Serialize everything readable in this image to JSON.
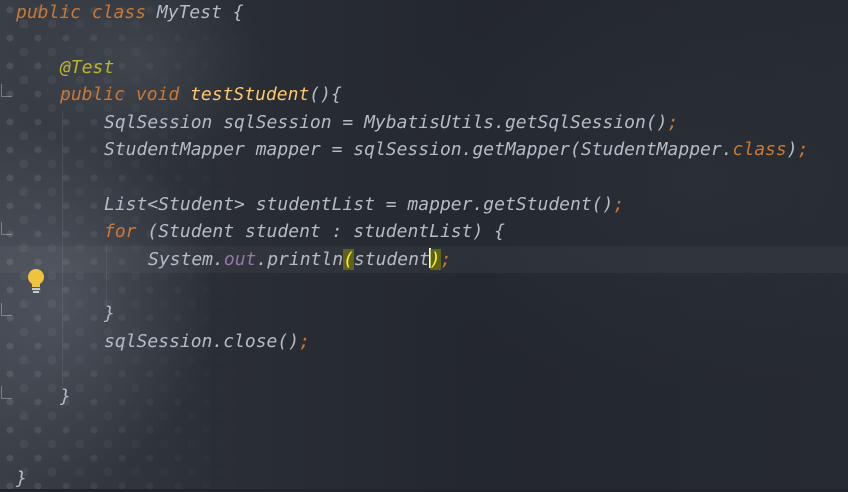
{
  "editor": {
    "lines": [
      {
        "indent": 0,
        "tokens": [
          {
            "t": "public",
            "c": "kw"
          },
          {
            "t": " ",
            "c": "plain"
          },
          {
            "t": "class",
            "c": "kw"
          },
          {
            "t": " MyTest {",
            "c": "plain"
          }
        ]
      },
      {
        "indent": 0,
        "tokens": []
      },
      {
        "indent": 1,
        "tokens": [
          {
            "t": "@Test",
            "c": "ann"
          }
        ]
      },
      {
        "indent": 1,
        "tokens": [
          {
            "t": "public",
            "c": "kw"
          },
          {
            "t": " ",
            "c": "plain"
          },
          {
            "t": "void",
            "c": "kw"
          },
          {
            "t": " ",
            "c": "plain"
          },
          {
            "t": "testStudent",
            "c": "fn"
          },
          {
            "t": "(){",
            "c": "plain"
          }
        ]
      },
      {
        "indent": 2,
        "tokens": [
          {
            "t": "SqlSession sqlSession = MybatisUtils.getSqlSession()",
            "c": "plain"
          },
          {
            "t": ";",
            "c": "punct"
          }
        ]
      },
      {
        "indent": 2,
        "tokens": [
          {
            "t": "StudentMapper mapper = sqlSession.getMapper(StudentMapper.",
            "c": "plain"
          },
          {
            "t": "class",
            "c": "kw"
          },
          {
            "t": ")",
            "c": "plain"
          },
          {
            "t": ";",
            "c": "punct"
          }
        ]
      },
      {
        "indent": 0,
        "tokens": []
      },
      {
        "indent": 2,
        "tokens": [
          {
            "t": "List<Student> studentList = mapper.getStudent()",
            "c": "plain"
          },
          {
            "t": ";",
            "c": "punct"
          }
        ]
      },
      {
        "indent": 2,
        "tokens": [
          {
            "t": "for",
            "c": "kw"
          },
          {
            "t": " (Student student : studentList) {",
            "c": "plain"
          }
        ]
      },
      {
        "indent": 3,
        "caret_line": true,
        "tokens": [
          {
            "t": "System.",
            "c": "plain"
          },
          {
            "t": "out",
            "c": "field"
          },
          {
            "t": ".println",
            "c": "plain"
          },
          {
            "t": "(",
            "c": "match"
          },
          {
            "t": "student",
            "c": "plain"
          },
          {
            "t": "CARET",
            "c": "caret"
          },
          {
            "t": ")",
            "c": "match"
          },
          {
            "t": ";",
            "c": "punct"
          }
        ]
      },
      {
        "indent": 0,
        "tokens": []
      },
      {
        "indent": 2,
        "tokens": [
          {
            "t": "}",
            "c": "plain"
          }
        ]
      },
      {
        "indent": 2,
        "tokens": [
          {
            "t": "sqlSession.close()",
            "c": "plain"
          },
          {
            "t": ";",
            "c": "punct"
          }
        ]
      },
      {
        "indent": 0,
        "tokens": []
      },
      {
        "indent": 1,
        "tokens": [
          {
            "t": "}",
            "c": "plain"
          }
        ]
      },
      {
        "indent": 0,
        "tokens": []
      },
      {
        "indent": 0,
        "tokens": []
      },
      {
        "indent": 0,
        "tokens": [
          {
            "t": "}",
            "c": "plain"
          }
        ]
      }
    ]
  },
  "gutter": {
    "intention_icon": "lightbulb-icon"
  },
  "colors": {
    "keyword": "#cc7832",
    "annotation": "#bbb529",
    "method_decl": "#ffc66d",
    "static_field": "#9876aa",
    "text": "#b4bcc6",
    "brace_match_bg": "#8a8a00"
  }
}
